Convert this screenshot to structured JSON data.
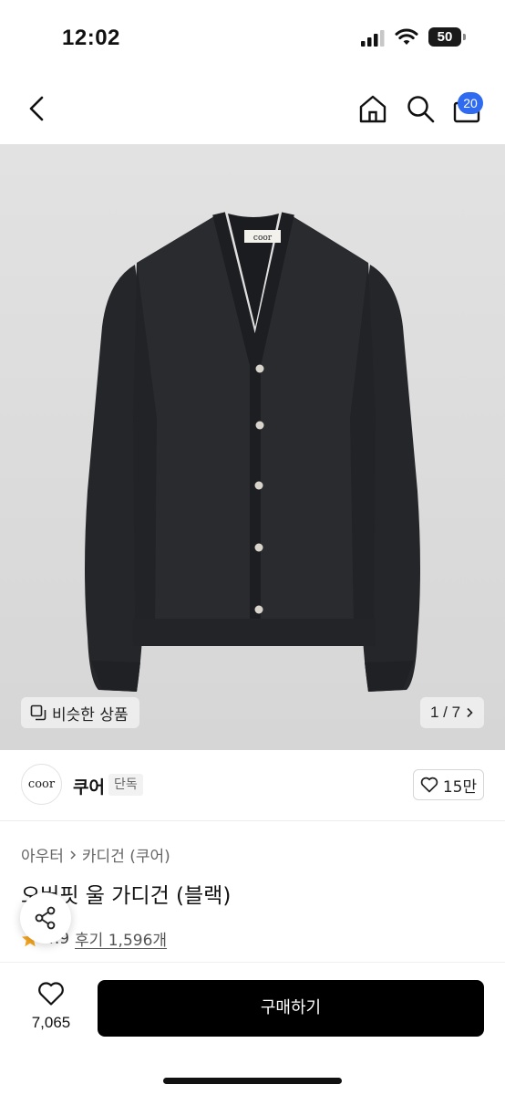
{
  "status": {
    "time": "12:02",
    "battery": "50"
  },
  "nav": {
    "cart_count": "20"
  },
  "gallery": {
    "label_on_garment": "coor",
    "similar_label": "비슷한 상품",
    "pager": "1 / 7"
  },
  "brand": {
    "logo_text": "coor",
    "name": "쿠어",
    "tag": "단독",
    "likes": "15만"
  },
  "breadcrumb": {
    "category": "아우터",
    "subcategory": "카디건 (쿠어)"
  },
  "product": {
    "title": "오버핏 울 가디건 (블랙)",
    "rating": "4.9",
    "reviews": "후기 1,596개"
  },
  "bottom": {
    "wish_count": "7,065",
    "buy_label": "구매하기"
  },
  "colors": {
    "accent": "#2f6bf0",
    "star": "#f5a623",
    "garment": "#262729"
  }
}
